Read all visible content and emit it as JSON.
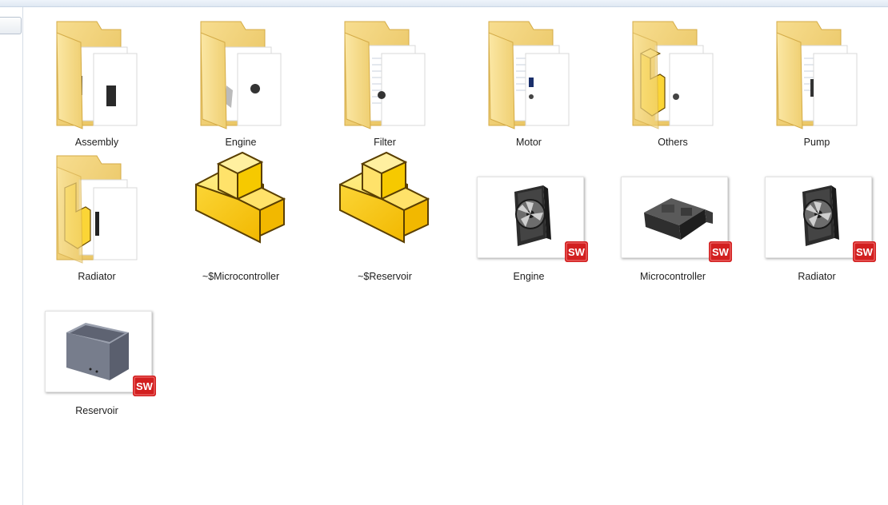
{
  "items": [
    {
      "label": "Assembly"
    },
    {
      "label": "Engine"
    },
    {
      "label": "Filter"
    },
    {
      "label": "Motor"
    },
    {
      "label": "Others"
    },
    {
      "label": "Pump"
    },
    {
      "label": "Radiator"
    },
    {
      "label": "~$Microcontroller"
    },
    {
      "label": "~$Reservoir"
    },
    {
      "label": "Engine"
    },
    {
      "label": "Microcontroller"
    },
    {
      "label": "Radiator"
    },
    {
      "label": "Reservoir"
    }
  ],
  "badge": {
    "text": "SW"
  },
  "colors": {
    "folder": "#f5d77c",
    "folder_dark": "#e0b84e",
    "part_yellow": "#fbd536",
    "sw_red": "#d21f1f"
  }
}
